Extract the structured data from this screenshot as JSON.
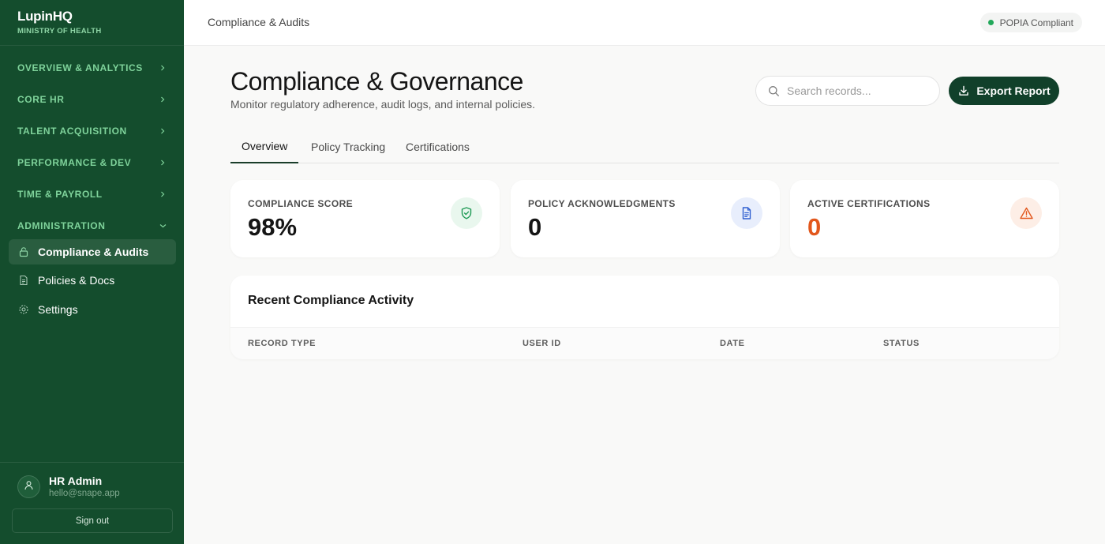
{
  "brand": {
    "name": "LupinHQ",
    "subtitle": "MINISTRY OF HEALTH"
  },
  "sidebar": {
    "sections": [
      {
        "label": "OVERVIEW & ANALYTICS",
        "expanded": false
      },
      {
        "label": "CORE HR",
        "expanded": false
      },
      {
        "label": "TALENT ACQUISITION",
        "expanded": false
      },
      {
        "label": "PERFORMANCE & DEV",
        "expanded": false
      },
      {
        "label": "TIME & PAYROLL",
        "expanded": false
      },
      {
        "label": "ADMINISTRATION",
        "expanded": true
      }
    ],
    "items": [
      {
        "label": "Compliance & Audits",
        "icon": "lock-icon",
        "active": true
      },
      {
        "label": "Policies & Docs",
        "icon": "document-icon",
        "active": false
      },
      {
        "label": "Settings",
        "icon": "gear-icon",
        "active": false
      }
    ],
    "user": {
      "name": "HR Admin",
      "email": "hello@snape.app",
      "sign_out_label": "Sign out"
    }
  },
  "topbar": {
    "breadcrumb": "Compliance & Audits",
    "status_badge": "POPIA Compliant"
  },
  "header": {
    "title": "Compliance & Governance",
    "subtitle": "Monitor regulatory adherence, audit logs, and internal policies.",
    "search_placeholder": "Search records...",
    "export_label": "Export Report"
  },
  "tabs": [
    {
      "label": "Overview",
      "active": true
    },
    {
      "label": "Policy Tracking",
      "active": false
    },
    {
      "label": "Certifications",
      "active": false
    }
  ],
  "stats": [
    {
      "label": "COMPLIANCE SCORE",
      "value": "98%",
      "icon": "shield-check-icon",
      "value_color": "#151515",
      "icon_bg": "#e9f7ee",
      "icon_color": "#1f9a55"
    },
    {
      "label": "POLICY ACKNOWLEDGMENTS",
      "value": "0",
      "icon": "document-icon",
      "value_color": "#151515",
      "icon_bg": "#e8eefc",
      "icon_color": "#2f5fd0"
    },
    {
      "label": "ACTIVE CERTIFICATIONS",
      "value": "0",
      "icon": "warning-icon",
      "value_color": "#e2571c",
      "icon_bg": "#fdeee6",
      "icon_color": "#e2571c"
    }
  ],
  "activity": {
    "title": "Recent Compliance Activity",
    "columns": [
      "RECORD TYPE",
      "USER ID",
      "DATE",
      "STATUS"
    ],
    "rows": []
  }
}
